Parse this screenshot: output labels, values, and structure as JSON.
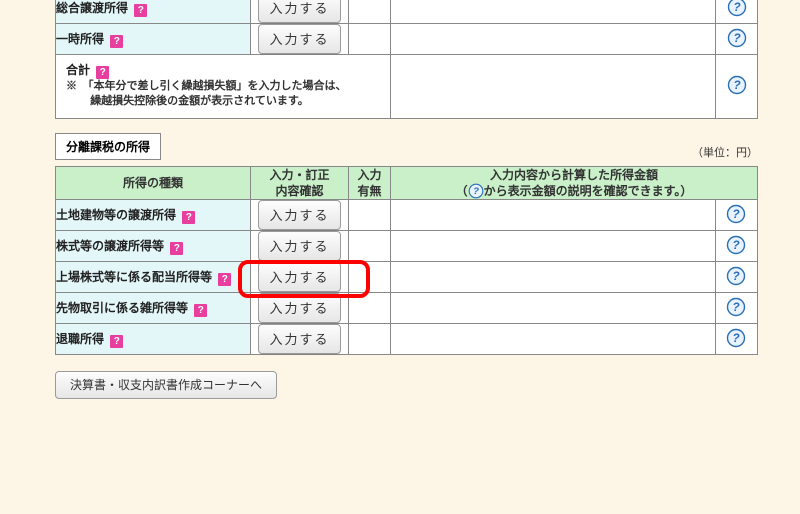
{
  "buttons": {
    "input": "入力する",
    "kessansho": "決算書・収支内訳書作成コーナーへ"
  },
  "top_rows": {
    "r0": {
      "name": "総合譲渡所得"
    },
    "r1": {
      "name": "一時所得"
    },
    "total": {
      "name": "合計",
      "note1": "※　「本年分で差し引く繰越損失額」を入力した場合は、",
      "note2": "繰越損失控除後の金額が表示されています。"
    }
  },
  "section": {
    "title": "分離課税の所得",
    "unit": "（単位：円）"
  },
  "headers": {
    "name": "所得の種類",
    "btn": "入力・訂正\n内容確認",
    "flag": "入力\n有無",
    "amount_l1": "入力内容から計算した所得金額",
    "amount_l2_a": "（",
    "amount_l2_b": "から表示金額の説明を確認できます。）"
  },
  "sep_rows": {
    "r0": {
      "name": "土地建物等の譲渡所得"
    },
    "r1": {
      "name": "株式等の譲渡所得等"
    },
    "r2": {
      "name": "上場株式等に係る配当所得等"
    },
    "r3": {
      "name": "先物取引に係る雑所得等"
    },
    "r4": {
      "name": "退職所得"
    }
  }
}
